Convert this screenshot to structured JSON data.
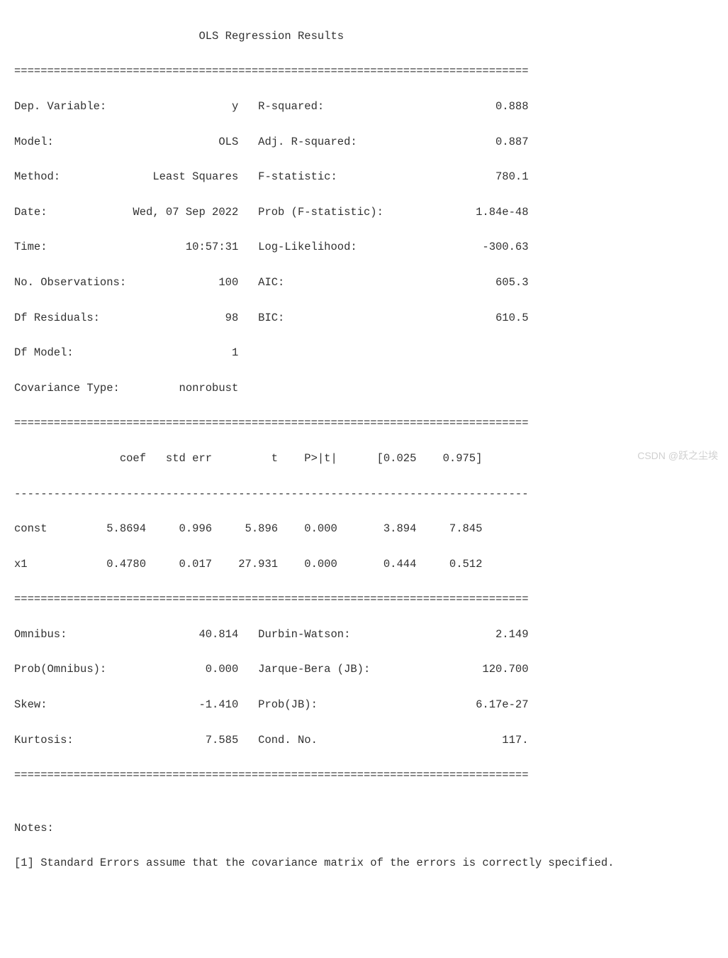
{
  "title": "OLS Regression Results",
  "width": 78,
  "section1_left": [
    {
      "label": "Dep. Variable:",
      "value": "y"
    },
    {
      "label": "Model:",
      "value": "OLS"
    },
    {
      "label": "Method:",
      "value": "Least Squares"
    },
    {
      "label": "Date:",
      "value": "Wed, 07 Sep 2022"
    },
    {
      "label": "Time:",
      "value": "10:57:31"
    },
    {
      "label": "No. Observations:",
      "value": "100"
    },
    {
      "label": "Df Residuals:",
      "value": "98"
    },
    {
      "label": "Df Model:",
      "value": "1"
    },
    {
      "label": "Covariance Type:",
      "value": "nonrobust"
    }
  ],
  "section1_right": [
    {
      "label": "R-squared:",
      "value": "0.888"
    },
    {
      "label": "Adj. R-squared:",
      "value": "0.887"
    },
    {
      "label": "F-statistic:",
      "value": "780.1"
    },
    {
      "label": "Prob (F-statistic):",
      "value": "1.84e-48"
    },
    {
      "label": "Log-Likelihood:",
      "value": "-300.63"
    },
    {
      "label": "AIC:",
      "value": "605.3"
    },
    {
      "label": "BIC:",
      "value": "610.5"
    }
  ],
  "coefs": {
    "columns": [
      "",
      "coef",
      "std err",
      "t",
      "P>|t|",
      "[0.025",
      "0.975]"
    ],
    "rows": [
      {
        "name": "const",
        "coef": "5.8694",
        "stderr": "0.996",
        "t": "5.896",
        "p": "0.000",
        "lo": "3.894",
        "hi": "7.845"
      },
      {
        "name": "x1",
        "coef": "0.4780",
        "stderr": "0.017",
        "t": "27.931",
        "p": "0.000",
        "lo": "0.444",
        "hi": "0.512"
      }
    ]
  },
  "section3_left": [
    {
      "label": "Omnibus:",
      "value": "40.814"
    },
    {
      "label": "Prob(Omnibus):",
      "value": "0.000"
    },
    {
      "label": "Skew:",
      "value": "-1.410"
    },
    {
      "label": "Kurtosis:",
      "value": "7.585"
    }
  ],
  "section3_right": [
    {
      "label": "Durbin-Watson:",
      "value": "2.149"
    },
    {
      "label": "Jarque-Bera (JB):",
      "value": "120.700"
    },
    {
      "label": "Prob(JB):",
      "value": "6.17e-27"
    },
    {
      "label": "Cond. No.",
      "value": "117."
    }
  ],
  "notes": {
    "label": "Notes:",
    "lines": [
      "[1] Standard Errors assume that the covariance matrix of the errors is correctly specified."
    ]
  },
  "watermark": "CSDN @跃之尘埃",
  "titleLine": "",
  "hr": "",
  "dash": "",
  "blank": "",
  "sec1": {},
  "sec3": {},
  "coefHeader": "",
  "coefRows": [],
  "notesLabel": "",
  "notesLine1": ""
}
